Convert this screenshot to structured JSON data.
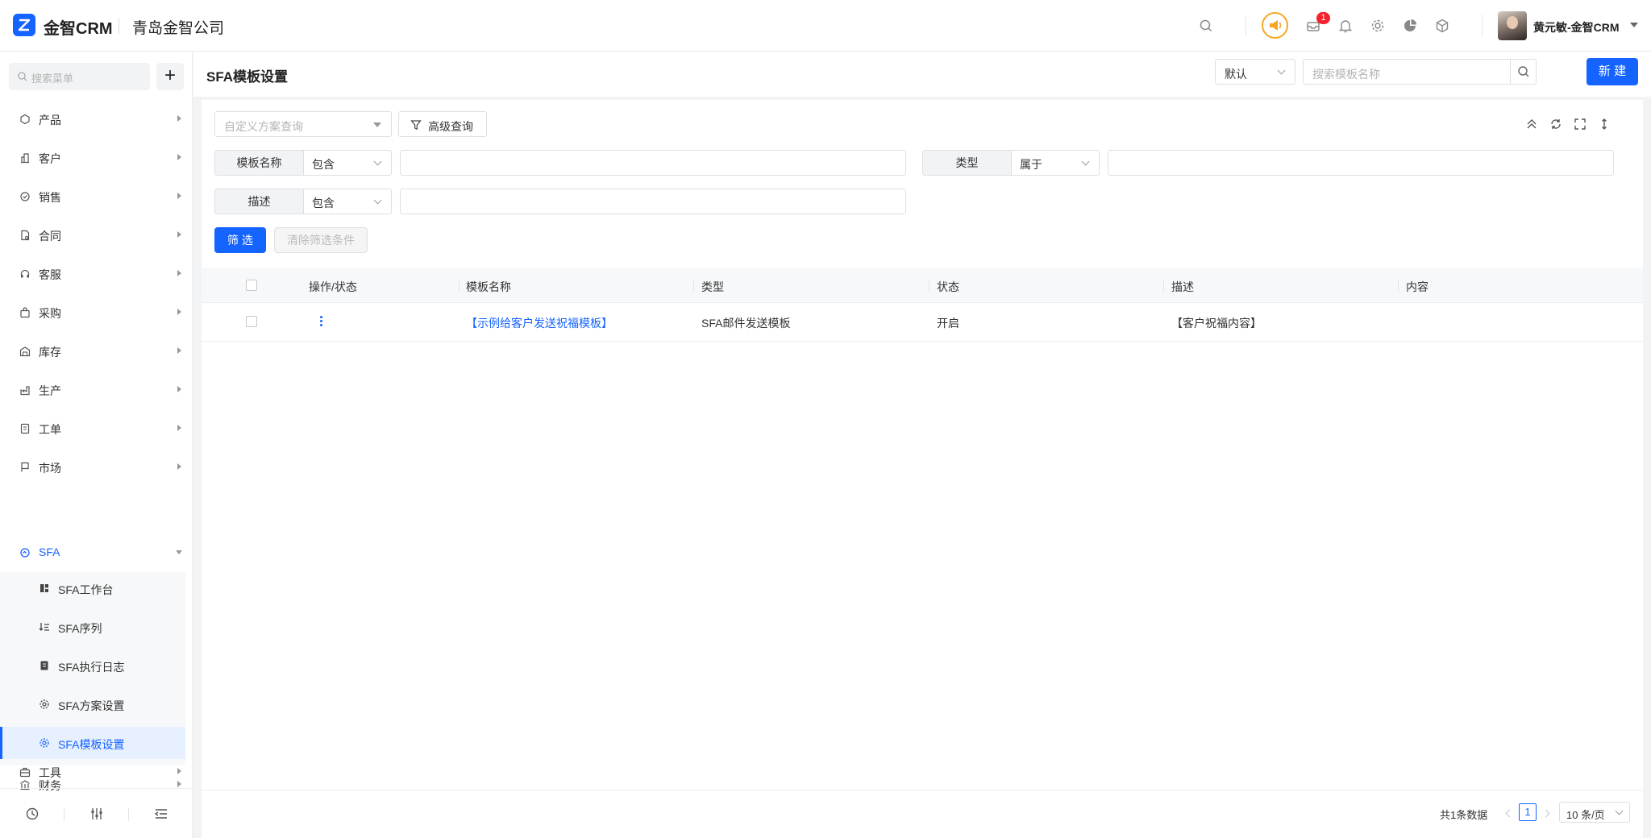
{
  "header": {
    "app_name": "金智CRM",
    "company": "青岛金智公司",
    "notification_count": "1",
    "username": "黄元敏-金智CRM",
    "accent_color": "#1564ff"
  },
  "sidebar": {
    "search_placeholder": "搜索菜单",
    "add_label": "+",
    "menu": [
      {
        "label": "产品",
        "icon": "cube-icon"
      },
      {
        "label": "客户",
        "icon": "building-icon"
      },
      {
        "label": "销售",
        "icon": "badge-icon"
      },
      {
        "label": "合同",
        "icon": "contract-icon"
      },
      {
        "label": "客服",
        "icon": "headset-icon"
      },
      {
        "label": "采购",
        "icon": "bag-icon"
      },
      {
        "label": "库存",
        "icon": "warehouse-icon"
      },
      {
        "label": "生产",
        "icon": "factory-icon"
      },
      {
        "label": "工单",
        "icon": "ticket-icon"
      },
      {
        "label": "市场",
        "icon": "flag-icon"
      },
      {
        "label": "SFA",
        "icon": "sfa-icon"
      },
      {
        "label": "财务",
        "icon": "finance-icon"
      },
      {
        "label": "工具",
        "icon": "toolbox-icon"
      }
    ],
    "sfa_sub": [
      {
        "label": "SFA工作台",
        "icon": "dashboard-icon"
      },
      {
        "label": "SFA序列",
        "icon": "sequence-icon"
      },
      {
        "label": "SFA执行日志",
        "icon": "log-icon"
      },
      {
        "label": "SFA方案设置",
        "icon": "gear-icon"
      },
      {
        "label": "SFA模板设置",
        "icon": "gear-icon"
      }
    ]
  },
  "page": {
    "title": "SFA模板设置",
    "view_select": "默认",
    "search_placeholder": "搜索模板名称",
    "new_button": "新 建"
  },
  "filter": {
    "scheme_placeholder": "自定义方案查询",
    "advanced_label": "高级查询",
    "conditions": [
      {
        "field": "模板名称",
        "operator": "包含",
        "value": ""
      },
      {
        "field": "类型",
        "operator": "属于",
        "value": ""
      },
      {
        "field": "描述",
        "operator": "包含",
        "value": ""
      }
    ],
    "apply_label": "筛 选",
    "clear_label": "清除筛选条件"
  },
  "table": {
    "columns": [
      "操作/状态",
      "模板名称",
      "类型",
      "状态",
      "描述",
      "内容"
    ],
    "rows": [
      {
        "name": "【示例给客户发送祝福模板】",
        "type": "SFA邮件发送模板",
        "status": "开启",
        "description": "【客户祝福内容】",
        "content": ""
      }
    ]
  },
  "pagination": {
    "total": "共1条数据",
    "current_page": "1",
    "page_size": "10 条/页"
  }
}
